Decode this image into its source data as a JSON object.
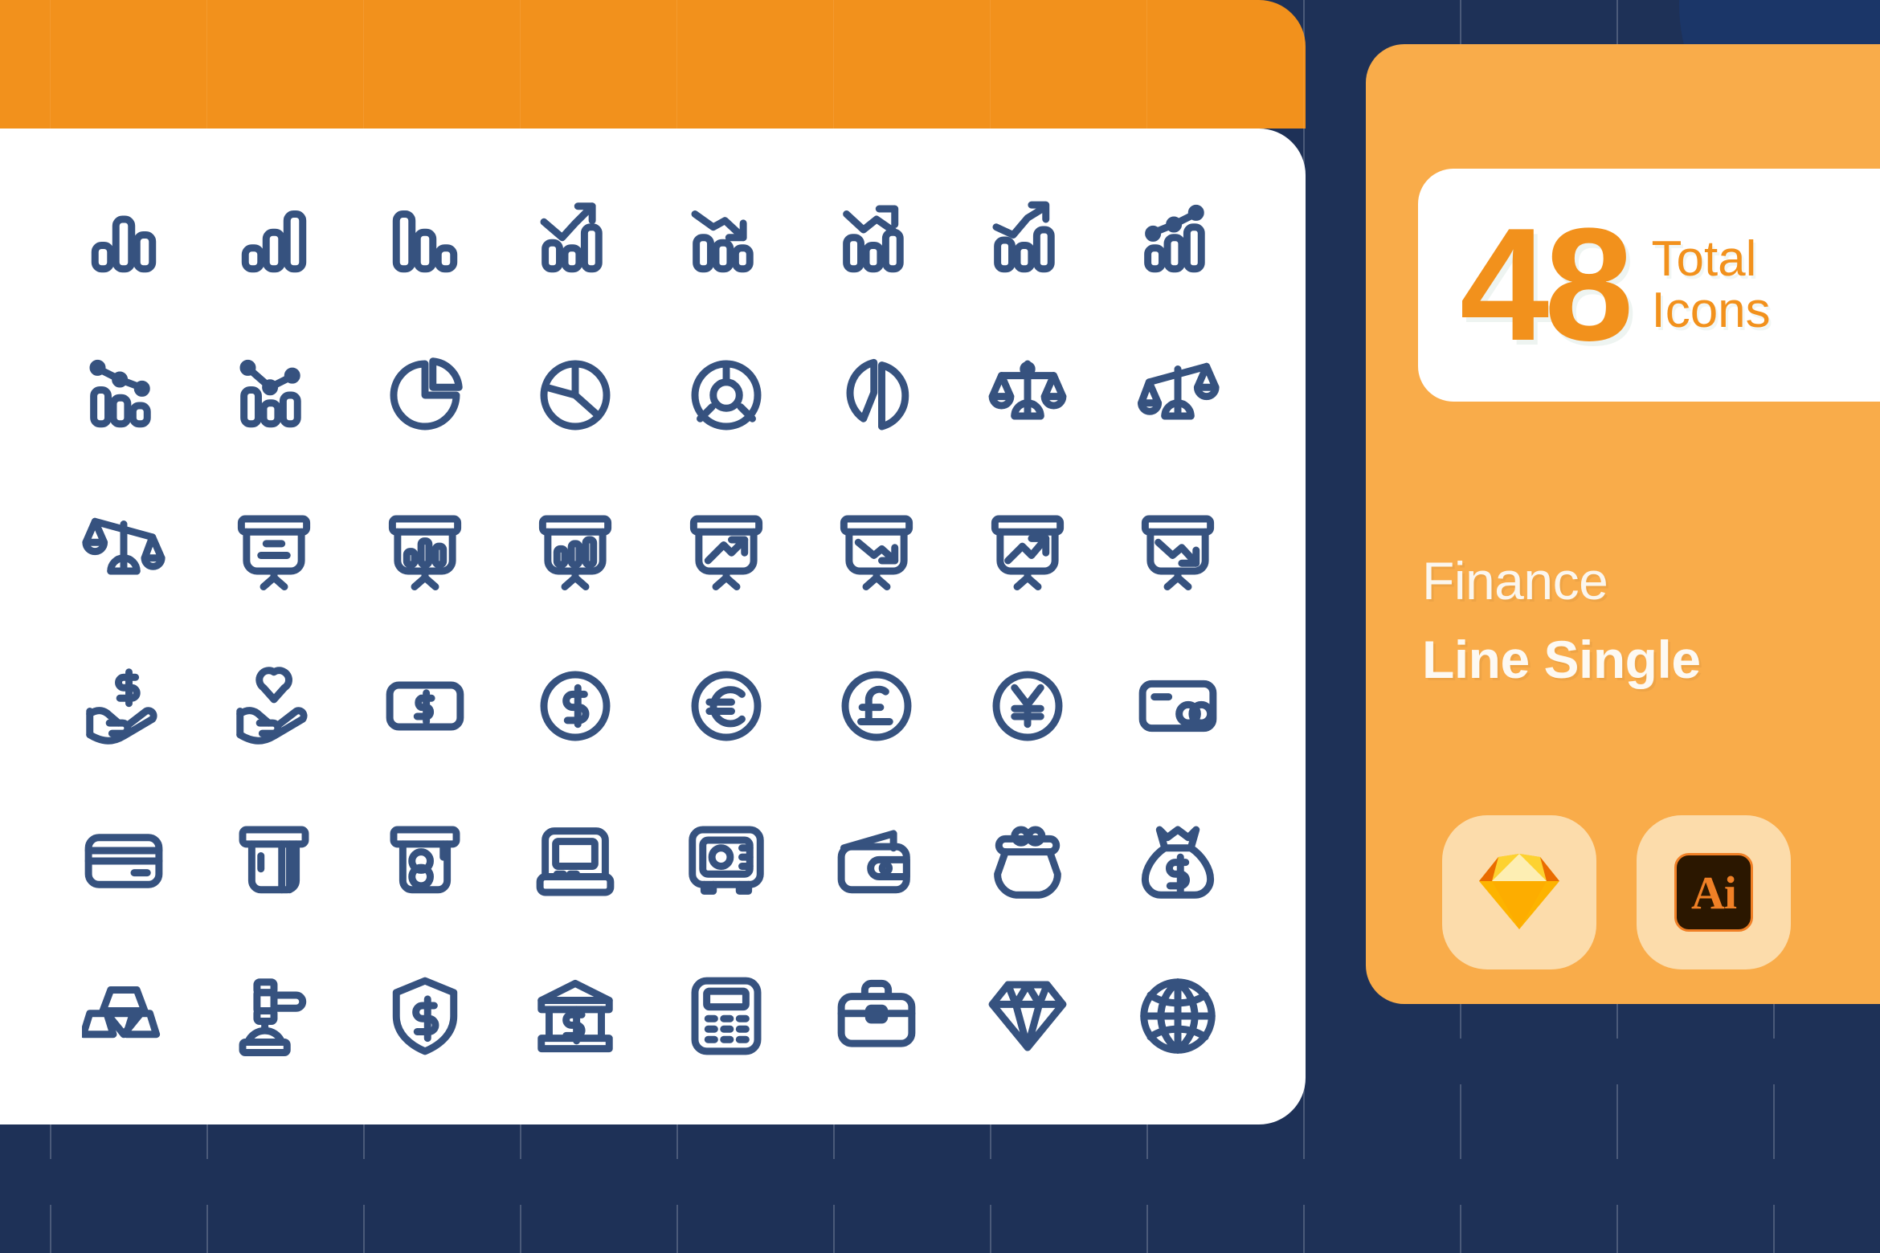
{
  "theme": {
    "background": "#1e3157",
    "header_orange": "#f2911c",
    "panel_orange": "#f9ac4a",
    "card_white": "#ffffff",
    "icon_stroke": "#36527f",
    "badge_bg": "#fcdcab",
    "ai_badge_bg": "#2b1700",
    "ai_badge_fg": "#f08026"
  },
  "sidebar": {
    "total_count": "48",
    "total_label_line1": "Total",
    "total_label_line2": "Icons",
    "pack_name_line1": "Finance",
    "pack_name_line2": "Line Single",
    "badges": [
      {
        "name": "sketch-badge",
        "label": "Sketch"
      },
      {
        "name": "illustrator-badge",
        "label": "Ai"
      }
    ]
  },
  "icon_grid": {
    "columns": 8,
    "rows": 6,
    "icons": [
      {
        "id": "bar-chart-middle-high",
        "label": "Bar Chart"
      },
      {
        "id": "bar-chart-ascending",
        "label": "Bar Chart Ascending"
      },
      {
        "id": "bar-chart-descending",
        "label": "Bar Chart Descending"
      },
      {
        "id": "bar-chart-growth-arrow",
        "label": "Growth Bar Chart"
      },
      {
        "id": "bar-chart-decline-arrow",
        "label": "Decline Bar Chart"
      },
      {
        "id": "bar-chart-line-down",
        "label": "Bar Chart Line Down"
      },
      {
        "id": "bar-chart-line-up",
        "label": "Bar Chart Line Up"
      },
      {
        "id": "bar-chart-dot-line-up",
        "label": "Bar Chart Dot Line Up"
      },
      {
        "id": "bar-chart-dot-line-down",
        "label": "Bar Chart Dot Line Down"
      },
      {
        "id": "bar-chart-dot-line-v",
        "label": "Bar Chart Dot Line V"
      },
      {
        "id": "pie-chart-slice",
        "label": "Pie Chart Slice"
      },
      {
        "id": "pie-chart-thirds",
        "label": "Pie Chart Thirds"
      },
      {
        "id": "donut-chart",
        "label": "Donut Chart"
      },
      {
        "id": "pie-chart-exploded",
        "label": "Exploded Pie Chart"
      },
      {
        "id": "balance-scale-even",
        "label": "Balance Scale"
      },
      {
        "id": "balance-scale-tilt-right",
        "label": "Scale Tilted Right"
      },
      {
        "id": "balance-scale-tilt-left",
        "label": "Scale Tilted Left"
      },
      {
        "id": "presentation-board-text",
        "label": "Presentation Text"
      },
      {
        "id": "presentation-board-bars",
        "label": "Presentation Bars"
      },
      {
        "id": "presentation-board-bars-alt",
        "label": "Presentation Bars Alt"
      },
      {
        "id": "presentation-board-arrow-up",
        "label": "Presentation Arrow Up"
      },
      {
        "id": "presentation-board-arrow-down",
        "label": "Presentation Arrow Down"
      },
      {
        "id": "presentation-board-line-up",
        "label": "Presentation Line Up"
      },
      {
        "id": "presentation-board-line-down",
        "label": "Presentation Line Down"
      },
      {
        "id": "hand-holding-dollar",
        "label": "Hand Holding Dollar"
      },
      {
        "id": "hand-holding-heart",
        "label": "Hand Holding Heart"
      },
      {
        "id": "banknote-dollar",
        "label": "Banknote"
      },
      {
        "id": "coin-dollar",
        "label": "Dollar Coin"
      },
      {
        "id": "coin-euro",
        "label": "Euro Coin"
      },
      {
        "id": "coin-pound",
        "label": "Pound Coin"
      },
      {
        "id": "coin-yen",
        "label": "Yen Coin"
      },
      {
        "id": "payment-card-dual-circles",
        "label": "Payment Card"
      },
      {
        "id": "credit-card-stripe",
        "label": "Credit Card"
      },
      {
        "id": "card-in-slot",
        "label": "Card In Slot"
      },
      {
        "id": "cash-withdrawal",
        "label": "Cash Withdrawal"
      },
      {
        "id": "atm-machine",
        "label": "ATM Machine"
      },
      {
        "id": "safe-vault",
        "label": "Safe Vault"
      },
      {
        "id": "wallet",
        "label": "Wallet"
      },
      {
        "id": "coin-purse",
        "label": "Coin Purse"
      },
      {
        "id": "money-bag-dollar",
        "label": "Money Bag"
      },
      {
        "id": "gold-bars",
        "label": "Gold Bars"
      },
      {
        "id": "auction-gavel",
        "label": "Auction Gavel"
      },
      {
        "id": "shield-dollar",
        "label": "Shield Dollar"
      },
      {
        "id": "bank-building-dollar",
        "label": "Bank Building"
      },
      {
        "id": "calculator",
        "label": "Calculator"
      },
      {
        "id": "briefcase",
        "label": "Briefcase"
      },
      {
        "id": "diamond",
        "label": "Diamond"
      },
      {
        "id": "globe",
        "label": "Globe"
      }
    ]
  }
}
